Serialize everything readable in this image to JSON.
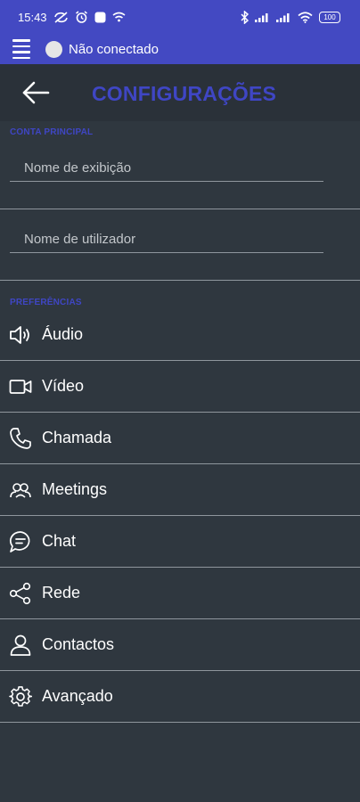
{
  "status_bar": {
    "time": "15:43",
    "battery": "100",
    "left_icons": [
      "sync-off-icon",
      "alarm-icon",
      "app-icon",
      "wifi-settings-icon"
    ],
    "right_icons": [
      "bluetooth-icon",
      "signal-icon",
      "signal-icon",
      "wifi-icon",
      "battery-icon"
    ]
  },
  "top_bar": {
    "connection_status": "Não conectado",
    "menu_icon": "hamburger-icon"
  },
  "header": {
    "title": "CONFIGURAÇÕES",
    "back_icon": "arrow-left-icon"
  },
  "account_section": {
    "label": "CONTA PRINCIPAL",
    "fields": [
      {
        "placeholder": "Nome de exibição",
        "value": ""
      },
      {
        "placeholder": "Nome de utilizador",
        "value": ""
      }
    ]
  },
  "preferences_section": {
    "label": "PREFERÊNCIAS",
    "items": [
      {
        "label": "Áudio",
        "icon": "speaker-icon"
      },
      {
        "label": "Vídeo",
        "icon": "video-camera-icon"
      },
      {
        "label": "Chamada",
        "icon": "phone-icon"
      },
      {
        "label": "Meetings",
        "icon": "group-icon"
      },
      {
        "label": "Chat",
        "icon": "chat-bubble-icon"
      },
      {
        "label": "Rede",
        "icon": "share-network-icon"
      },
      {
        "label": "Contactos",
        "icon": "person-icon"
      },
      {
        "label": "Avançado",
        "icon": "gear-icon"
      }
    ]
  },
  "colors": {
    "accent": "#4349c2",
    "section_label": "#3f46c4",
    "background": "#2f373f",
    "header_background": "#2a3139",
    "divider": "#8f969d"
  }
}
